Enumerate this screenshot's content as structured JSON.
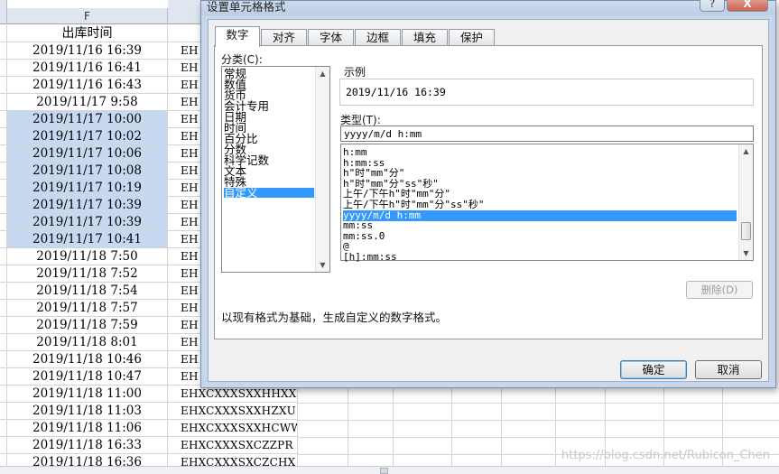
{
  "sheet": {
    "column_letter": "F",
    "column_title": "出库时间",
    "dates": [
      "2019/11/16 16:39",
      "2019/11/16 16:41",
      "2019/11/16 16:43",
      "2019/11/17 9:58",
      "2019/11/17 10:00",
      "2019/11/17 10:02",
      "2019/11/17 10:06",
      "2019/11/17 10:08",
      "2019/11/17 10:19",
      "2019/11/17 10:39",
      "2019/11/17 10:39",
      "2019/11/17 10:41",
      "2019/11/18 7:50",
      "2019/11/18 7:52",
      "2019/11/18 7:54",
      "2019/11/18 7:57",
      "2019/11/18 7:59",
      "2019/11/18 8:01",
      "2019/11/18 10:46",
      "2019/11/18 10:47",
      "2019/11/18 11:00",
      "2019/11/18 11:03",
      "2019/11/18 11:06",
      "2019/11/18 16:33",
      "2019/11/18 16:36"
    ],
    "codes": [
      "EH",
      "EH",
      "EH",
      "EH",
      "EH",
      "EH",
      "EH",
      "EH",
      "EH",
      "EH",
      "EH",
      "EH",
      "EH",
      "EH",
      "EH",
      "EH",
      "EH",
      "EH",
      "EH",
      "EH",
      "EHXCXXXSXXHHXX",
      "EHXCXXXSXXHZXU",
      "EHXCXXXSXXHCWW",
      "EHXCXXXSXCZZPR",
      "EHXCXXXSXCZCHX"
    ],
    "selected_rows_from": 4,
    "selected_rows_to": 11,
    "watermark": "https://blog.csdn.net/Rubicon_Chen"
  },
  "dialog": {
    "title": "设置单元格格式",
    "help_label": "?",
    "close_label": "X",
    "tabs": [
      "数字",
      "对齐",
      "字体",
      "边框",
      "填充",
      "保护"
    ],
    "active_tab": 0,
    "category_label": "分类(C):",
    "categories": [
      "常规",
      "数值",
      "货币",
      "会计专用",
      "日期",
      "时间",
      "百分比",
      "分数",
      "科学记数",
      "文本",
      "特殊",
      "自定义"
    ],
    "selected_category": 11,
    "sample_label": "示例",
    "sample_value": "2019/11/16 16:39",
    "type_label": "类型(T):",
    "type_value": "yyyy/m/d h:mm",
    "formats": [
      "h:mm",
      "h:mm:ss",
      "h\"时\"mm\"分\"",
      "h\"时\"mm\"分\"ss\"秒\"",
      "上午/下午h\"时\"mm\"分\"",
      "上午/下午h\"时\"mm\"分\"ss\"秒\"",
      "yyyy/m/d h:mm",
      "mm:ss",
      "mm:ss.0",
      "@",
      "[h]:mm:ss"
    ],
    "selected_format": 6,
    "delete_label": "删除(D)",
    "description": "以现有格式为基础，生成自定义的数字格式。",
    "ok_label": "确定",
    "cancel_label": "取消"
  }
}
